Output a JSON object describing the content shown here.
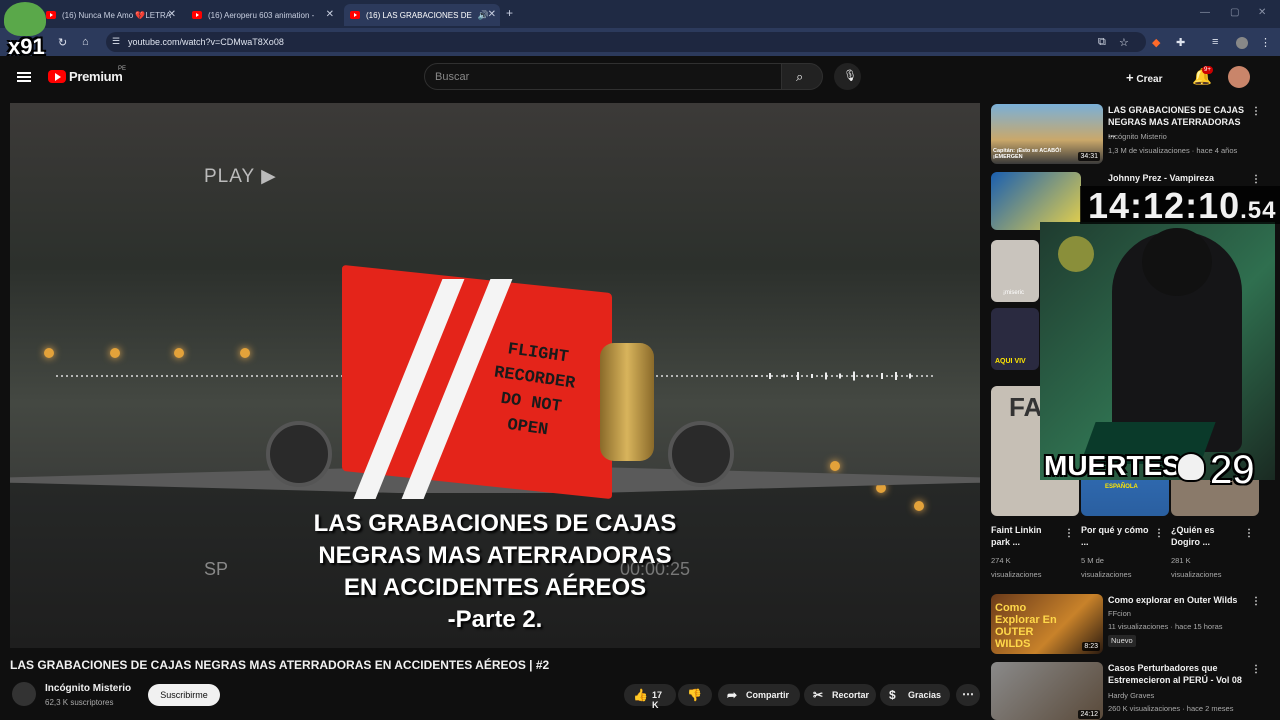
{
  "browser": {
    "tabs": [
      {
        "title": "(16) Nunca Me Amo 💔LETRA"
      },
      {
        "title": "(16) Aeroperu 603 animation -"
      },
      {
        "title": "(16) LAS GRABACIONES DE"
      }
    ],
    "new_tab": "+",
    "url": "youtube.com/watch?v=CDMwaT8Xo08"
  },
  "youtube": {
    "brand": "Premium",
    "region": "PE",
    "search_placeholder": "Buscar",
    "create_label": "Crear",
    "notif_count": "9+"
  },
  "player": {
    "overlay_title_lines": [
      "LAS GRABACIONES DE CAJAS",
      "NEGRAS MAS ATERRADORAS",
      "EN ACCIDENTES AÉREOS",
      "-Parte 2."
    ],
    "box_text": [
      "FLIGHT",
      "RECORDER",
      "DO NOT",
      "OPEN"
    ],
    "play_text": "PLAY ▶",
    "sp_text": "SP",
    "time_text": "00:00:25"
  },
  "video": {
    "title": "LAS GRABACIONES DE CAJAS NEGRAS MAS ATERRADORAS EN ACCIDENTES AÉREOS | #2",
    "channel": "Incógnito Misterio",
    "subscribers": "62,3 K suscriptores",
    "subscribe_label": "Suscribirme",
    "likes": "17 K",
    "share_label": "Compartir",
    "clip_label": "Recortar",
    "thanks_label": "Gracias"
  },
  "sidebar": {
    "items": [
      {
        "title": "LAS GRABACIONES DE CAJAS NEGRAS MAS ATERRADORAS ...",
        "channel": "Incógnito Misterio",
        "meta": "1,3 M de visualizaciones · hace 4 años",
        "duration": "34:31",
        "thumb_caption": "Capitán: ¡Esto se ACABÓ! ¡EMERGEN"
      },
      {
        "title": "Johnny Prez - Vampireza"
      },
      {
        "title": "Como explorar en Outer Wilds",
        "channel": "FFcion",
        "meta": "11 visualizaciones · hace 15 horas",
        "badge": "Nuevo",
        "duration": "8:23",
        "thumb_caption": "Como Explorar En OUTER WILDS"
      },
      {
        "title": "Casos Perturbadores que Estremecieron al PERÚ - Vol 08",
        "channel": "Hardy Graves",
        "meta": "260 K visualizaciones · hace 2 meses",
        "duration": "24:12"
      }
    ],
    "shorts": [
      {
        "title": "Faint Linkin park ...",
        "views": "274 K",
        "views_label": "visualizaciones"
      },
      {
        "title": "Por qué y cómo ...",
        "views": "5 M de",
        "views_label": "visualizaciones"
      },
      {
        "title": "¿Quién es Dogiro ...",
        "views": "281 K",
        "views_label": "visualizaciones"
      }
    ],
    "thumb_labels": [
      "¡miseric",
      "AQUI VIV",
      "FA",
      "ESPAÑOLA"
    ]
  },
  "overlay": {
    "clock_main": "14:12:10",
    "clock_frac": ".54",
    "deaths_label": "MUERTES",
    "deaths_count": "29",
    "streamer_tag": "x91"
  }
}
